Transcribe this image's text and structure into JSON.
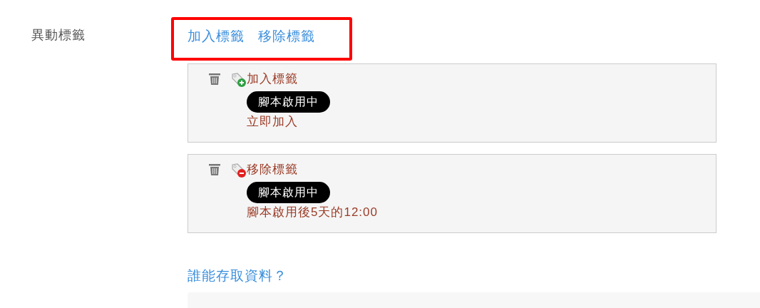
{
  "field_label": "異動標籤",
  "links": [
    "加入標籤",
    "移除標籤"
  ],
  "actions": [
    {
      "kind": "add",
      "title": "加入標籤",
      "badge": "腳本啟用中",
      "timing": "立即加入"
    },
    {
      "kind": "remove",
      "title": "移除標籤",
      "badge": "腳本啟用中",
      "timing": "腳本啟用後5天的12:00"
    }
  ],
  "access_link": "誰能存取資料？"
}
